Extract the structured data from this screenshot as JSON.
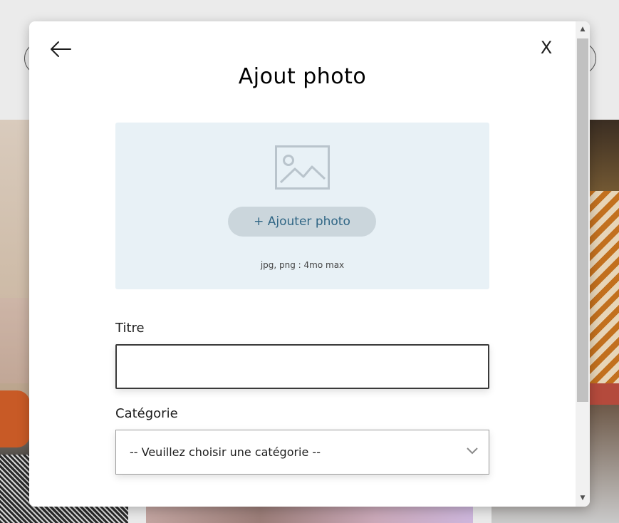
{
  "modal": {
    "title": "Ajout photo",
    "back_icon": "arrow-left-icon",
    "close_label": "X",
    "upload": {
      "placeholder_icon": "image-placeholder-icon",
      "button_label": "+ Ajouter photo",
      "hint": "jpg, png : 4mo max"
    },
    "fields": {
      "title_label": "Titre",
      "title_value": "",
      "category_label": "Catégorie",
      "category_selected": "-- Veuillez choisir une catégorie --",
      "category_icon": "chevron-down-icon"
    },
    "colors": {
      "upload_bg": "#e8f1f6",
      "button_bg": "#cbd6dc",
      "button_text": "#306685"
    }
  }
}
